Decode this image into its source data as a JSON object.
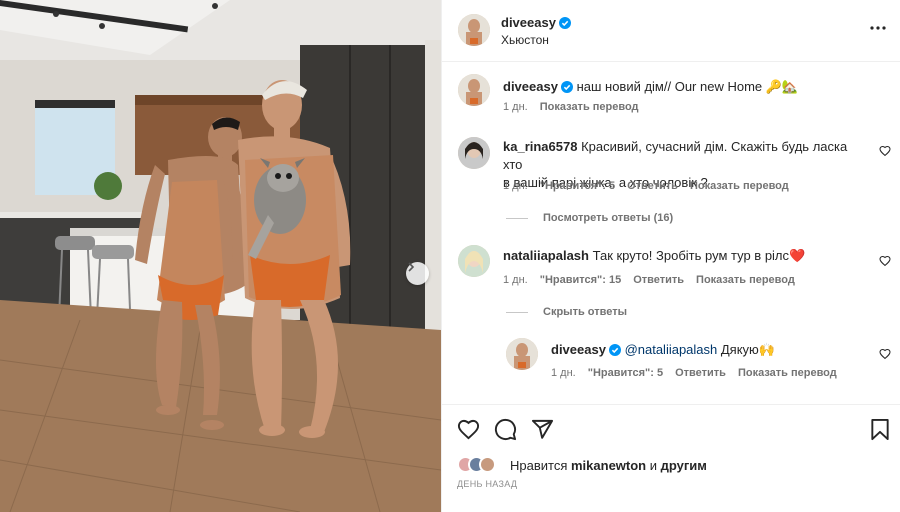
{
  "post": {
    "author": "diveeasy",
    "location": "Хьюстон",
    "caption_text": "наш новий дім// Our new Home 🔑🏡",
    "caption_time": "1 дн.",
    "caption_translate": "Показать перевод"
  },
  "comments": [
    {
      "user": "ka_rina6578",
      "text_line1": "Красивий, сучасний дім. Скажіть будь ласка хто",
      "text_line2": "в вашій парі жінка, а хто чоловік ?",
      "time": "1 дн.",
      "likes": "\"Нравится\": 5",
      "reply": "Ответить",
      "translate": "Показать перевод",
      "thread": "Посмотреть ответы (16)"
    },
    {
      "user": "nataliiapalash",
      "text": "Так круто! Зробіть рум тур в рілс❤️",
      "time": "1 дн.",
      "likes": "\"Нравится\": 15",
      "reply": "Ответить",
      "translate": "Показать перевод",
      "thread": "Скрыть ответы"
    }
  ],
  "reply": {
    "user": "diveeasy",
    "mention": "@nataliiapalash",
    "text": " Дякую🙌",
    "time": "1 дн.",
    "likes": "\"Нравится\": 5",
    "reply": "Ответить",
    "translate": "Показать перевод"
  },
  "footer": {
    "liked_prefix": "Нравится",
    "liked_user": "mikanewton",
    "liked_suffix": " и ",
    "liked_others": "другим",
    "posted": "ДЕНЬ НАЗАД"
  },
  "icons": {
    "heart": "heart-icon",
    "comment": "comment-icon",
    "share": "share-icon",
    "save": "bookmark-icon",
    "more": "more-options-icon",
    "verified": "verified-badge-icon",
    "next": "chevron-right-icon"
  },
  "colors": {
    "verified": "#0095f6",
    "text": "#262626",
    "muted": "#737373",
    "mention": "#00376b"
  }
}
